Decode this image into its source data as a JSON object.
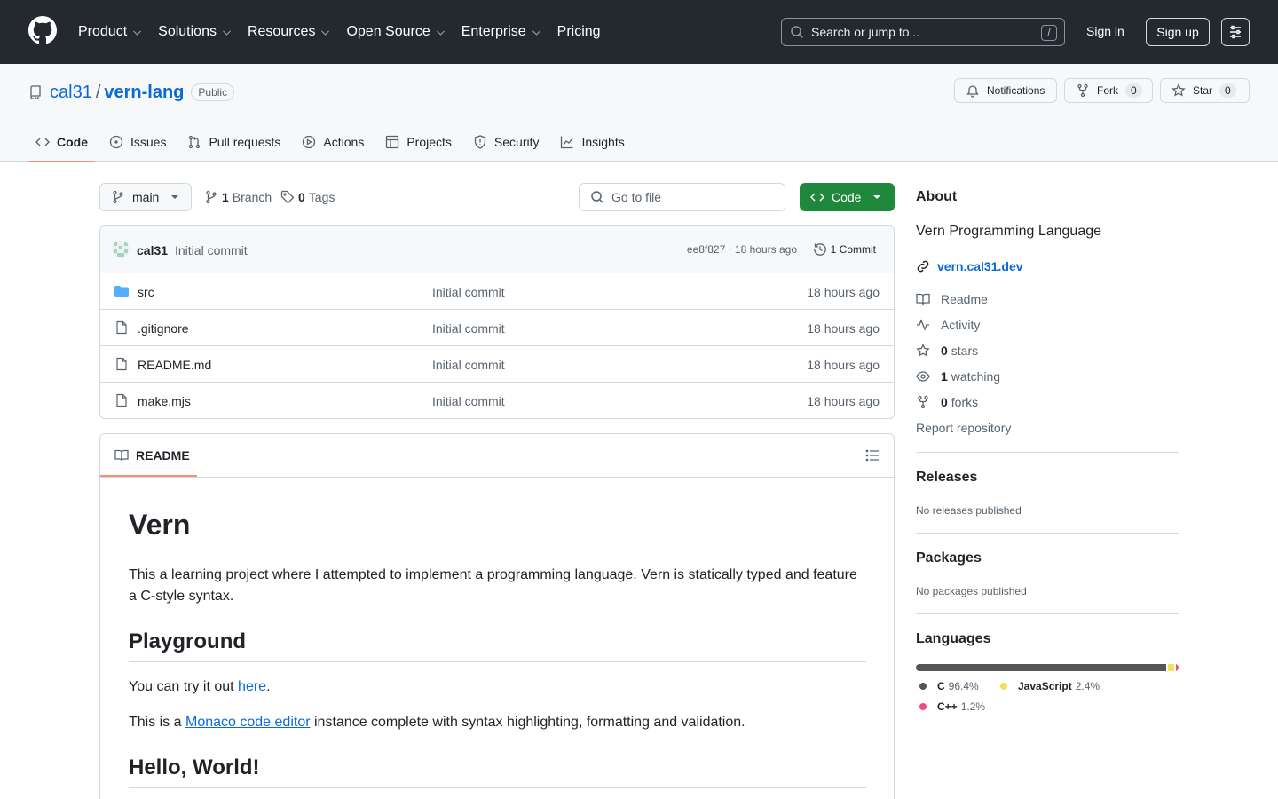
{
  "header": {
    "nav": [
      {
        "label": "Product"
      },
      {
        "label": "Solutions"
      },
      {
        "label": "Resources"
      },
      {
        "label": "Open Source"
      },
      {
        "label": "Enterprise"
      },
      {
        "label": "Pricing"
      }
    ],
    "search_placeholder": "Search or jump to...",
    "search_key": "/",
    "sign_in": "Sign in",
    "sign_up": "Sign up"
  },
  "repo": {
    "owner": "cal31",
    "separator": "/",
    "name": "vern-lang",
    "visibility": "Public",
    "notifications_label": "Notifications",
    "fork_label": "Fork",
    "fork_count": "0",
    "star_label": "Star",
    "star_count": "0",
    "tabs": [
      {
        "label": "Code",
        "icon": "code-icon"
      },
      {
        "label": "Issues",
        "icon": "issue-icon"
      },
      {
        "label": "Pull requests",
        "icon": "pull-request-icon"
      },
      {
        "label": "Actions",
        "icon": "play-icon"
      },
      {
        "label": "Projects",
        "icon": "table-icon"
      },
      {
        "label": "Security",
        "icon": "shield-icon"
      },
      {
        "label": "Insights",
        "icon": "graph-icon"
      }
    ]
  },
  "toolbar": {
    "branch": "main",
    "branch_count": "1",
    "branch_label": "Branch",
    "tag_count": "0",
    "tag_label": "Tags",
    "goto_placeholder": "Go to file",
    "code_label": "Code"
  },
  "commit": {
    "author": "cal31",
    "message": "Initial commit",
    "hash_time": "ee8f827 · 18 hours ago",
    "count_label": "1 Commit"
  },
  "files": [
    {
      "name": "src",
      "type": "folder",
      "message": "Initial commit",
      "time": "18 hours ago"
    },
    {
      "name": ".gitignore",
      "type": "file",
      "message": "Initial commit",
      "time": "18 hours ago"
    },
    {
      "name": "README.md",
      "type": "file",
      "message": "Initial commit",
      "time": "18 hours ago"
    },
    {
      "name": "make.mjs",
      "type": "file",
      "message": "Initial commit",
      "time": "18 hours ago"
    }
  ],
  "readme": {
    "tab_label": "README",
    "title": "Vern",
    "intro": "This a learning project where I attempted to implement a programming language. Vern is statically typed and feature a C-style syntax.",
    "h_playground": "Playground",
    "try_before": "You can try it out ",
    "try_link": "here",
    "try_after": ".",
    "monaco_before": "This is a ",
    "monaco_link": "Monaco code editor",
    "monaco_after": " instance complete with syntax highlighting, formatting and validation.",
    "h_hello": "Hello, World!"
  },
  "about": {
    "title": "About",
    "description": "Vern Programming Language",
    "website": "vern.cal31.dev",
    "readme": "Readme",
    "activity": "Activity",
    "stars_count": "0",
    "stars_label": "stars",
    "watching_count": "1",
    "watching_label": "watching",
    "forks_count": "0",
    "forks_label": "forks",
    "report": "Report repository"
  },
  "releases": {
    "title": "Releases",
    "note": "No releases published"
  },
  "packages": {
    "title": "Packages",
    "note": "No packages published"
  },
  "languages": {
    "title": "Languages",
    "items": [
      {
        "name": "C",
        "percent": "96.4%",
        "value": 96.4,
        "color": "#555555"
      },
      {
        "name": "JavaScript",
        "percent": "2.4%",
        "value": 2.4,
        "color": "#f1e05a"
      },
      {
        "name": "C++",
        "percent": "1.2%",
        "value": 1.2,
        "color": "#f34b7d"
      }
    ]
  }
}
